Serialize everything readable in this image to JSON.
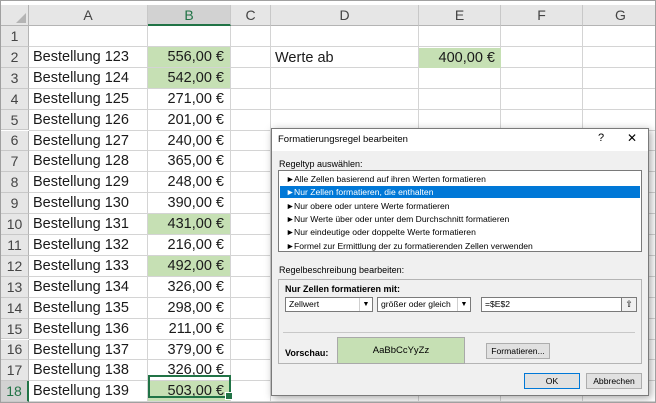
{
  "columns": [
    "A",
    "B",
    "C",
    "D",
    "E",
    "F",
    "G"
  ],
  "rows": [
    "1",
    "2",
    "3",
    "4",
    "5",
    "6",
    "7",
    "8",
    "9",
    "10",
    "11",
    "12",
    "13",
    "14",
    "15",
    "16",
    "17",
    "18"
  ],
  "sheet": {
    "orders": [
      {
        "name": "Bestellung 123",
        "value": "556,00 €",
        "highlight": true
      },
      {
        "name": "Bestellung 124",
        "value": "542,00 €",
        "highlight": true
      },
      {
        "name": "Bestellung 125",
        "value": "271,00 €",
        "highlight": false
      },
      {
        "name": "Bestellung 126",
        "value": "201,00 €",
        "highlight": false
      },
      {
        "name": "Bestellung 127",
        "value": "240,00 €",
        "highlight": false
      },
      {
        "name": "Bestellung 128",
        "value": "365,00 €",
        "highlight": false
      },
      {
        "name": "Bestellung 129",
        "value": "248,00 €",
        "highlight": false
      },
      {
        "name": "Bestellung 130",
        "value": "390,00 €",
        "highlight": false
      },
      {
        "name": "Bestellung 131",
        "value": "431,00 €",
        "highlight": true
      },
      {
        "name": "Bestellung 132",
        "value": "216,00 €",
        "highlight": false
      },
      {
        "name": "Bestellung 133",
        "value": "492,00 €",
        "highlight": true
      },
      {
        "name": "Bestellung 134",
        "value": "326,00 €",
        "highlight": false
      },
      {
        "name": "Bestellung 135",
        "value": "298,00 €",
        "highlight": false
      },
      {
        "name": "Bestellung 136",
        "value": "211,00 €",
        "highlight": false
      },
      {
        "name": "Bestellung 137",
        "value": "379,00 €",
        "highlight": false
      },
      {
        "name": "Bestellung 138",
        "value": "326,00 €",
        "highlight": false
      },
      {
        "name": "Bestellung 139",
        "value": "503,00 €",
        "highlight": true
      }
    ],
    "threshold_label": "Werte ab",
    "threshold_value": "400,00 €",
    "active_cell": "B18"
  },
  "colors": {
    "highlight_fill": "#c6e0b4",
    "selection": "#217346",
    "dialog_selection": "#0078d7"
  },
  "dialog": {
    "title": "Formatierungsregel bearbeiten",
    "help": "?",
    "close": "✕",
    "rule_type_label": "Regeltyp auswählen:",
    "rule_types": [
      "Alle Zellen basierend auf ihren Werten formatieren",
      "Nur Zellen formatieren, die enthalten",
      "Nur obere oder untere Werte formatieren",
      "Nur Werte über oder unter dem Durchschnitt formatieren",
      "Nur eindeutige oder doppelte Werte formatieren",
      "Formel zur Ermittlung der zu formatierenden Zellen verwenden"
    ],
    "selected_rule_index": 1,
    "arrow_glyph": "►",
    "description_label": "Regelbeschreibung bearbeiten:",
    "format_only_label": "Nur Zellen formatieren mit:",
    "condition_field": "Zellwert",
    "operator": "größer oder gleich",
    "formula": "=$E$2",
    "preview_label": "Vorschau:",
    "preview_text": "AaBbCcYyZz",
    "format_button": "Formatieren...",
    "ok_button": "OK",
    "cancel_button": "Abbrechen"
  }
}
